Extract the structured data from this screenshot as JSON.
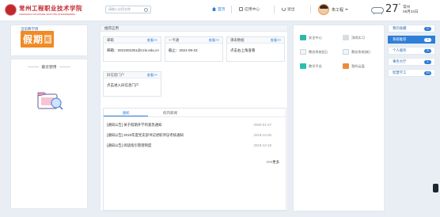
{
  "header": {
    "logo_cn": "常州工程职业技术学院",
    "logo_en": "CHANGZHOU VOCATIONAL INSTITUTE OF ENGINEERING",
    "search_placeholder": "请输入应用名称",
    "nav": {
      "home": "首页",
      "apps": "应用中心",
      "logout": "退出"
    },
    "user_name": "朱工程",
    "weather": {
      "temp": "27",
      "unit": "°",
      "city": "常州",
      "date": "08月24日"
    }
  },
  "left": {
    "caption": "当前教学周",
    "holiday_text": "假期",
    "holiday_suffix": "周",
    "recent_title": "最近使用"
  },
  "center": {
    "title": "推荐应用",
    "cards": [
      {
        "title": "邮箱",
        "more": "查看>>",
        "body": "邮箱：2021001051@czie.edu.cn"
      },
      {
        "title": "一卡通",
        "more": "查看>>",
        "body": "截止：2021-08-23"
      },
      {
        "title": "课表数据",
        "more": "查看>>",
        "body": "点击右上角查看"
      },
      {
        "title": "旧信息门户",
        "more": "查看>>",
        "body": "点击进入旧信息门户"
      }
    ],
    "news": {
      "tabs": [
        "通知",
        "校内新闻"
      ],
      "items": [
        {
          "text": "[通知公告] 关于假期开学的紧急通知",
          "date": "2020-01-27"
        },
        {
          "text": "[通知公告] 2019年度党支部书记述职评议考核通知",
          "date": "2019-12-20"
        },
        {
          "text": "[通知公告] 阅读指引管理制度",
          "date": "2019-12-18"
        }
      ],
      "more": ">>>更多"
    }
  },
  "apps": [
    {
      "label": "安全中心",
      "color": "#2fb8a8"
    },
    {
      "label": "顶岗实习",
      "color": "#d7dde4"
    },
    {
      "label": "教务系统(旧)",
      "color": "#f3f5f8"
    },
    {
      "label": "教务系统(新)",
      "color": "#f3f5f8"
    },
    {
      "label": "教学平台",
      "color": "#24c2b0"
    },
    {
      "label": "我的云盘",
      "color": "#ee8a3a"
    }
  ],
  "right_menu": [
    {
      "label": "我的收藏",
      "count": "0"
    },
    {
      "label": "系统推荐",
      "count": "6"
    },
    {
      "label": "个人服务",
      "count": "5"
    },
    {
      "label": "事务大厅",
      "count": "1"
    },
    {
      "label": "智慧学工",
      "count": "19"
    }
  ]
}
